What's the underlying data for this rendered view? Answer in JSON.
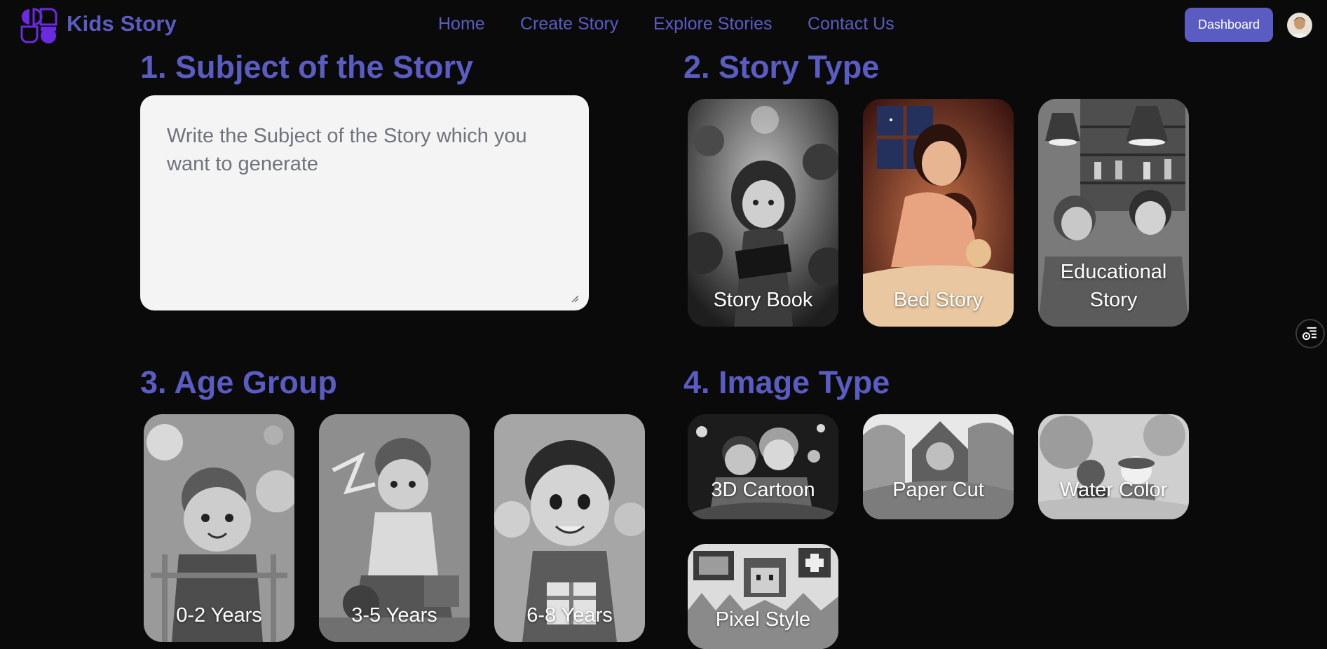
{
  "brand": {
    "name": "Kids Story",
    "accent": "#5a5cc2",
    "logo_color": "#6a2be0"
  },
  "nav": {
    "home": "Home",
    "create": "Create Story",
    "explore": "Explore Stories",
    "contact": "Contact Us"
  },
  "header": {
    "dashboard_label": "Dashboard"
  },
  "sections": {
    "subject": {
      "title": "1. Subject of the Story",
      "placeholder": "Write the Subject of the Story which you want to generate"
    },
    "story_type": {
      "title": "2. Story Type",
      "options": [
        "Story Book",
        "Bed Story",
        "Educational Story"
      ]
    },
    "age_group": {
      "title": "3. Age Group",
      "options": [
        "0-2 Years",
        "3-5 Years",
        "6-8 Years"
      ]
    },
    "image_type": {
      "title": "4. Image Type",
      "options": [
        "3D Cartoon",
        "Paper Cut",
        "Water Color",
        "Pixel Style"
      ]
    }
  },
  "icons": {
    "filter": "filter-settings-icon",
    "resize": "resize-grip-icon",
    "avatar": "user-avatar"
  }
}
